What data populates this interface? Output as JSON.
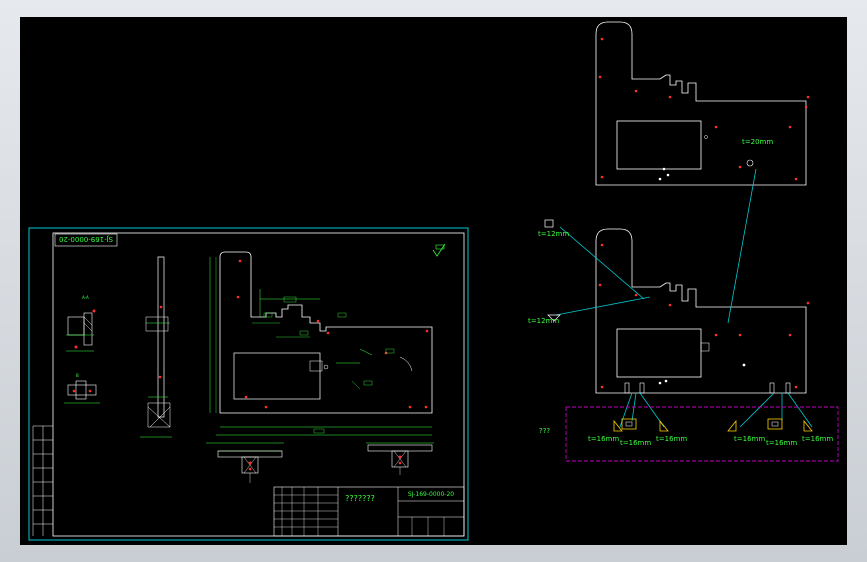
{
  "drawing": {
    "sheet_title_rotated": "SJ-169-0000-20",
    "title_block_name": "???????",
    "title_block_number": "SJ-169-0000-20",
    "thickness_top": "t=20mm",
    "callout_1": "t=12mm",
    "callout_2": "t=12mm",
    "callout_3": "t=16mm",
    "callout_4": "t=16mm",
    "callout_5": "t=16mm",
    "callout_6": "t=16mm",
    "callout_7": "t=16mm",
    "callout_8": "t=16mm",
    "legend_label": "???"
  },
  "colors": {
    "background": "#000000",
    "frame": "#00c8d0",
    "geometry": "#ffffff",
    "dimension": "#38ff3e",
    "leader": "#00c8d0",
    "marker": "#ff2e2e",
    "highlight": "#c400c4"
  }
}
